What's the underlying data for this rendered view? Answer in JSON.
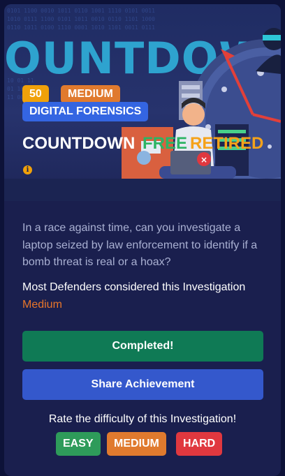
{
  "hero": {
    "banner_text": "OUNTDOWN",
    "points": "50",
    "level": "MEDIUM",
    "category": "DIGITAL FORENSICS",
    "title": "COUNTDOWN",
    "price_tag": "FREE",
    "status_tag": "RETIRED",
    "info_icon": "info-icon"
  },
  "body": {
    "description": "In a race against time, can you investigate a laptop seized by law enforcement to identify if a bomb threat is real or a hoax?",
    "consider_prefix": "Most Defenders considered this Investigation ",
    "consider_level": "Medium"
  },
  "actions": {
    "completed_label": "Completed!",
    "share_label": "Share Achievement"
  },
  "rating": {
    "prompt": "Rate the difficulty of this Investigation!",
    "easy": "EASY",
    "medium": "MEDIUM",
    "hard": "HARD"
  },
  "colors": {
    "card_bg": "#1a1f4e",
    "points": "#f0a10a",
    "medium": "#e07a2e",
    "category": "#3465e2",
    "free": "#2db464",
    "completed": "#0f7a55",
    "share": "#3458cc",
    "easy": "#2e9b5a",
    "hard": "#e0383f"
  }
}
